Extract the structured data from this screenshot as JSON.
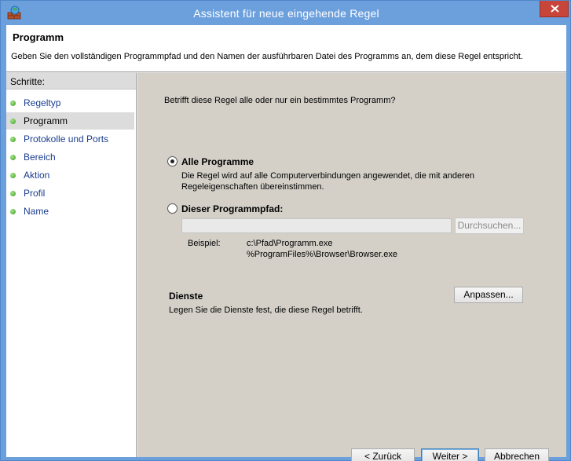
{
  "window": {
    "title": "Assistent für neue eingehende Regel"
  },
  "header": {
    "title": "Programm",
    "description": "Geben Sie den vollständigen Programmpfad und den Namen der ausführbaren Datei des Programms an, dem diese Regel entspricht."
  },
  "sidebar": {
    "heading": "Schritte:",
    "items": [
      {
        "label": "Regeltyp",
        "active": false
      },
      {
        "label": "Programm",
        "active": true
      },
      {
        "label": "Protokolle und Ports",
        "active": false
      },
      {
        "label": "Bereich",
        "active": false
      },
      {
        "label": "Aktion",
        "active": false
      },
      {
        "label": "Profil",
        "active": false
      },
      {
        "label": "Name",
        "active": false
      }
    ]
  },
  "main": {
    "question": "Betrifft diese Regel alle oder nur ein bestimmtes Programm?",
    "option_all": {
      "label": "Alle Programme",
      "description": "Die Regel wird auf alle Computerverbindungen angewendet, die mit anderen Regeleigenschaften übereinstimmen.",
      "checked": true
    },
    "option_path": {
      "label": "Dieser Programmpfad:",
      "checked": false,
      "value": "",
      "browse_label": "Durchsuchen..."
    },
    "example": {
      "label": "Beispiel:",
      "path1": "c:\\Pfad\\Programm.exe",
      "path2": "%ProgramFiles%\\Browser\\Browser.exe"
    },
    "services": {
      "title": "Dienste",
      "description": "Legen Sie die Dienste fest, die diese Regel betrifft.",
      "customize_label": "Anpassen..."
    }
  },
  "footer": {
    "back_label": "< Zurück",
    "next_label": "Weiter >",
    "cancel_label": "Abbrechen"
  },
  "colors": {
    "titlebar": "#6ca0dd",
    "close_button": "#c7453a",
    "step_link": "#1a3d8f",
    "step_dot": "#3c9a22",
    "content_bg": "#d4d0c8"
  }
}
